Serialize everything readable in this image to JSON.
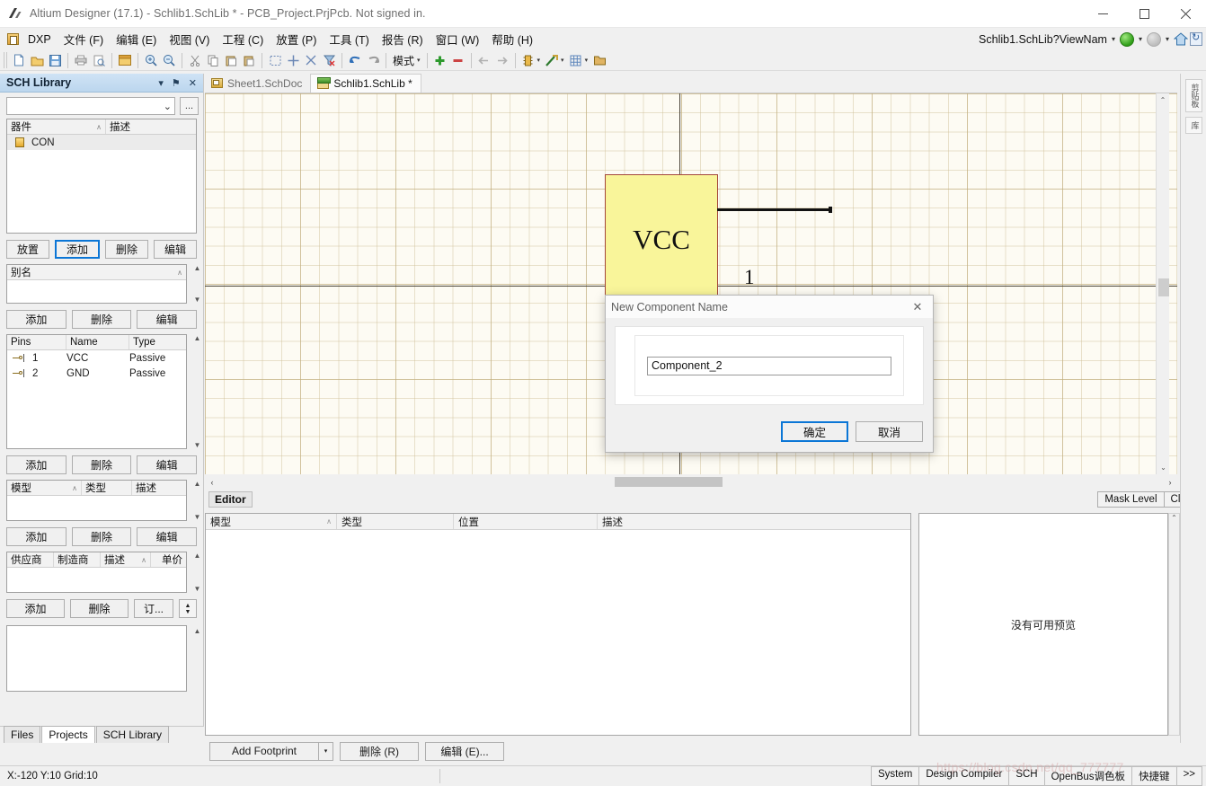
{
  "window": {
    "title": "Altium Designer (17.1) - Schlib1.SchLib * - PCB_Project.PrjPcb. Not signed in.",
    "minimize_label": "—",
    "maximize_label": "☐",
    "close_label": "✕"
  },
  "menubar": {
    "items": [
      {
        "label": "DXP"
      },
      {
        "label": "文件 (F)"
      },
      {
        "label": "编辑 (E)"
      },
      {
        "label": "视图 (V)"
      },
      {
        "label": "工程 (C)"
      },
      {
        "label": "放置 (P)"
      },
      {
        "label": "工具 (T)"
      },
      {
        "label": "报告 (R)"
      },
      {
        "label": "窗口 (W)"
      },
      {
        "label": "帮助 (H)"
      }
    ],
    "address": "Schlib1.SchLib?ViewNam",
    "caret": "▾"
  },
  "toolbar": {
    "mode_label": "模式",
    "caret": "▾",
    "plus": "+",
    "minus": "−"
  },
  "sidebar": {
    "title": "SCH Library",
    "controls": [
      "▾",
      "⚑",
      "✕"
    ],
    "library_combo_value": "",
    "library_combo_caret": "⌄",
    "browse_label": "...",
    "components": {
      "headers": [
        "器件",
        "描述"
      ],
      "sort_mark": "∧",
      "rows": [
        {
          "name": "CON",
          "description": ""
        }
      ]
    },
    "components_buttons": [
      {
        "label": "放置",
        "focused": false
      },
      {
        "label": "添加",
        "focused": true
      },
      {
        "label": "删除",
        "focused": false
      },
      {
        "label": "编辑",
        "focused": false
      }
    ],
    "alias": {
      "header": "别名",
      "sort_mark": "∧",
      "rows": []
    },
    "alias_buttons": [
      {
        "label": "添加"
      },
      {
        "label": "删除"
      },
      {
        "label": "编辑"
      }
    ],
    "pins": {
      "headers": [
        "Pins",
        "Name",
        "Type"
      ],
      "rows": [
        {
          "pin": "1",
          "name": "VCC",
          "type": "Passive"
        },
        {
          "pin": "2",
          "name": "GND",
          "type": "Passive"
        }
      ]
    },
    "pins_buttons": [
      {
        "label": "添加"
      },
      {
        "label": "删除"
      },
      {
        "label": "编辑"
      }
    ],
    "models": {
      "headers": [
        "模型",
        "类型",
        "描述"
      ],
      "sort_mark": "∧",
      "rows": []
    },
    "models_buttons": [
      {
        "label": "添加"
      },
      {
        "label": "删除"
      },
      {
        "label": "编辑"
      }
    ],
    "suppliers": {
      "headers": [
        "供应商",
        "制造商",
        "描述",
        "单价"
      ],
      "sort_mark": "∧",
      "rows": []
    },
    "supplier_buttons": [
      {
        "label": "添加"
      },
      {
        "label": "删除"
      },
      {
        "label": "订..."
      }
    ],
    "spinner_up": "▲",
    "spinner_down": "▼",
    "tabs": [
      {
        "label": "Files",
        "active": false
      },
      {
        "label": "Projects",
        "active": true
      },
      {
        "label": "SCH Library",
        "active": false
      }
    ]
  },
  "doctabs": [
    {
      "label": "Sheet1.SchDoc",
      "active": false
    },
    {
      "label": "Schlib1.SchLib *",
      "active": true
    }
  ],
  "canvas": {
    "component_label": "VCC",
    "pin_number": "1",
    "scroll_up": "⌃",
    "scroll_down": "⌄",
    "scroll_left": "‹",
    "scroll_right": "›"
  },
  "editorbar": {
    "tag": "Editor",
    "mask_level": "Mask Level",
    "clear": "Clear"
  },
  "lower_grid": {
    "headers": [
      "模型",
      "类型",
      "位置",
      "描述"
    ],
    "sort_mark": "∧",
    "rows": []
  },
  "preview": {
    "message": "没有可用预览",
    "scroll_up": "⌃",
    "scroll_down": "⌄"
  },
  "footprint_bar": {
    "add_footprint": "Add Footprint",
    "dropdown_caret": "▾",
    "delete": "删除 (R)",
    "edit": "编辑 (E)..."
  },
  "right_strip": {
    "tabs": [
      "剪贴板",
      "库"
    ]
  },
  "statusbar": {
    "coordinates": "X:-120 Y:10   Grid:10",
    "buttons": [
      {
        "label": "System"
      },
      {
        "label": "Design Compiler"
      },
      {
        "label": "SCH"
      },
      {
        "label": "OpenBus调色板"
      },
      {
        "label": "快捷键"
      },
      {
        "label": ">>"
      }
    ],
    "watermark": "https://blog.csdn.net/qq_777777"
  },
  "dialog": {
    "title": "New Component Name",
    "close_label": "✕",
    "input_value": "Component_2",
    "ok_label": "确定",
    "cancel_label": "取消"
  },
  "colors": {
    "component_fill": "#f9f59a",
    "component_border": "#a4463b",
    "accent_blue": "#0b76d6",
    "panel_header": "#cfe3f5",
    "canvas_bg": "#fdfbf3"
  }
}
